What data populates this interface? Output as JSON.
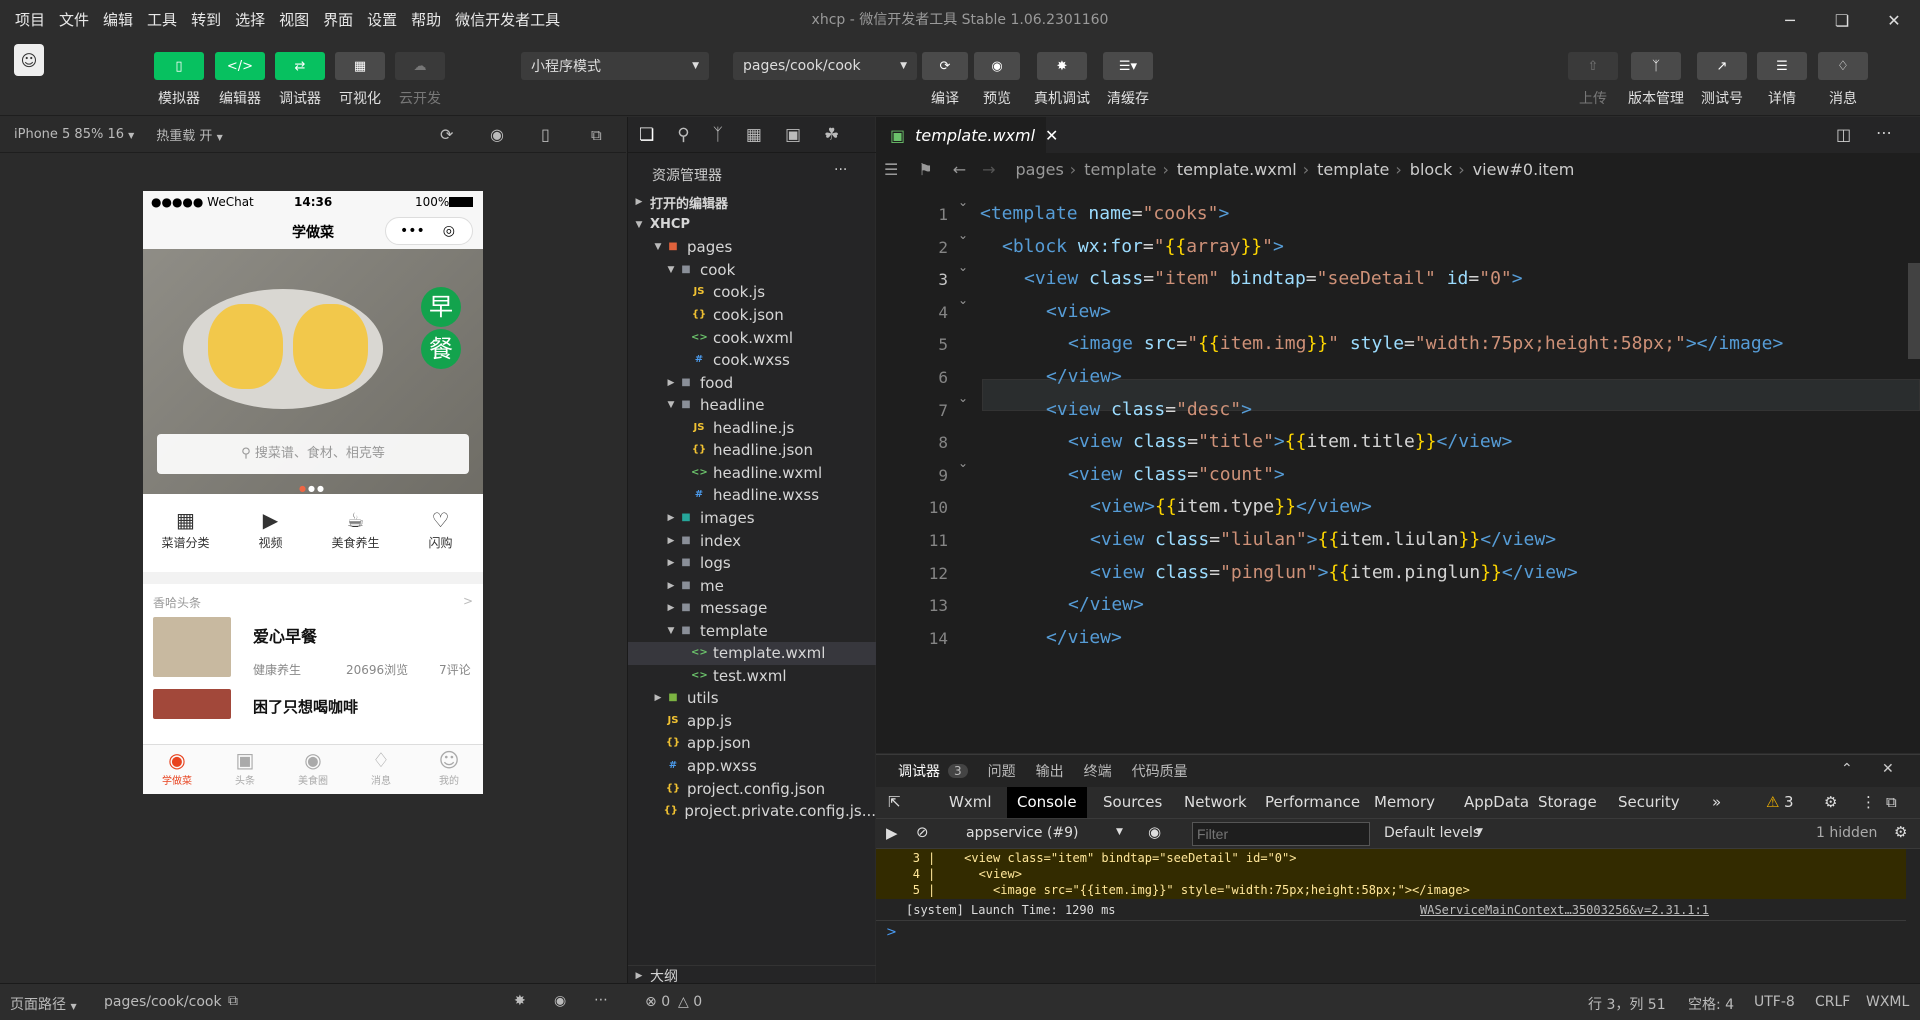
{
  "menubar": {
    "items": [
      "项目",
      "文件",
      "编辑",
      "工具",
      "转到",
      "选择",
      "视图",
      "界面",
      "设置",
      "帮助",
      "微信开发者工具"
    ],
    "title": "xhcp - 微信开发者工具 Stable 1.06.2301160"
  },
  "toolbar": {
    "simulator_label": "模拟器",
    "editor_label": "编辑器",
    "debugger_label": "调试器",
    "visual_label": "可视化",
    "cloud_label": "云开发",
    "mode_select": "小程序模式",
    "page_select": "pages/cook/cook",
    "compile_label": "编译",
    "preview_label": "预览",
    "remote_debug_label": "真机调试",
    "clear_cache_label": "清缓存",
    "upload_label": "上传",
    "version_label": "版本管理",
    "test_label": "测试号",
    "details_label": "详情",
    "messages_label": "消息"
  },
  "simulator": {
    "device": "iPhone 5 85% 16",
    "hot_reload": "热重载 开",
    "status_carrier": "●●●●● WeChat",
    "status_time": "14:36",
    "status_battery": "100%",
    "nav_title": "学做菜",
    "search_placeholder": "搜菜谱、食材、相克等",
    "banner_text_1": "早",
    "banner_text_2": "餐",
    "categories": [
      "菜谱分类",
      "视频",
      "美食养生",
      "闪购"
    ],
    "section_title": "香哈头条",
    "section_more": ">",
    "article1": {
      "title": "爱心早餐",
      "type": "健康养生",
      "views": "20696浏览",
      "comments": "7评论"
    },
    "article2": {
      "title": "困了只想喝咖啡"
    },
    "tabs": [
      "学做菜",
      "头条",
      "美食圈",
      "消息",
      "我的"
    ]
  },
  "explorer": {
    "title": "资源管理器",
    "more": "···",
    "open_editors": "打开的编辑器",
    "root": "XHCP",
    "tree": [
      {
        "label": "pages",
        "depth": 1,
        "type": "folder-red",
        "open": true
      },
      {
        "label": "cook",
        "depth": 2,
        "type": "folder",
        "open": true
      },
      {
        "label": "cook.js",
        "depth": 3,
        "type": "js"
      },
      {
        "label": "cook.json",
        "depth": 3,
        "type": "json"
      },
      {
        "label": "cook.wxml",
        "depth": 3,
        "type": "wxml"
      },
      {
        "label": "cook.wxss",
        "depth": 3,
        "type": "wxss"
      },
      {
        "label": "food",
        "depth": 2,
        "type": "folder",
        "open": false
      },
      {
        "label": "headline",
        "depth": 2,
        "type": "folder",
        "open": true
      },
      {
        "label": "headline.js",
        "depth": 3,
        "type": "js"
      },
      {
        "label": "headline.json",
        "depth": 3,
        "type": "json"
      },
      {
        "label": "headline.wxml",
        "depth": 3,
        "type": "wxml"
      },
      {
        "label": "headline.wxss",
        "depth": 3,
        "type": "wxss"
      },
      {
        "label": "images",
        "depth": 2,
        "type": "folder-img",
        "open": false
      },
      {
        "label": "index",
        "depth": 2,
        "type": "folder",
        "open": false
      },
      {
        "label": "logs",
        "depth": 2,
        "type": "folder",
        "open": false
      },
      {
        "label": "me",
        "depth": 2,
        "type": "folder",
        "open": false
      },
      {
        "label": "message",
        "depth": 2,
        "type": "folder",
        "open": false
      },
      {
        "label": "template",
        "depth": 2,
        "type": "folder",
        "open": true
      },
      {
        "label": "template.wxml",
        "depth": 3,
        "type": "wxml",
        "selected": true
      },
      {
        "label": "test.wxml",
        "depth": 3,
        "type": "wxml"
      },
      {
        "label": "utils",
        "depth": 1,
        "type": "folder-green",
        "open": false
      },
      {
        "label": "app.js",
        "depth": 1,
        "type": "js"
      },
      {
        "label": "app.json",
        "depth": 1,
        "type": "json"
      },
      {
        "label": "app.wxss",
        "depth": 1,
        "type": "wxss"
      },
      {
        "label": "project.config.json",
        "depth": 1,
        "type": "json"
      },
      {
        "label": "project.private.config.js...",
        "depth": 1,
        "type": "json"
      }
    ],
    "outline": "大纲"
  },
  "editor": {
    "tab": "template.wxml",
    "breadcrumb": [
      "pages",
      "template",
      "template.wxml",
      "template",
      "block",
      "view#0.item"
    ],
    "lines": [
      "1",
      "2",
      "3",
      "4",
      "5",
      "6",
      "7",
      "8",
      "9",
      "10",
      "11",
      "12",
      "13",
      "14"
    ]
  },
  "devtools": {
    "panel_tabs": [
      "调试器",
      "问题",
      "输出",
      "终端",
      "代码质量"
    ],
    "debugger_badge": "3",
    "tabs": [
      "Wxml",
      "Console",
      "Sources",
      "Network",
      "Performance",
      "Memory",
      "AppData",
      "Storage",
      "Security"
    ],
    "more_tabs": "»",
    "warn_count": "3",
    "context": "appservice (#9)",
    "filter_placeholder": "Filter",
    "levels": "Default levels",
    "hidden": "1 hidden",
    "warn_lines": [
      {
        "n": "3",
        "text": "    <view class=\"item\" bindtap=\"seeDetail\" id=\"0\">"
      },
      {
        "n": "4",
        "text": "      <view>"
      },
      {
        "n": "5",
        "text": "        <image src=\"{{item.img}}\" style=\"width:75px;height:58px;\"></image>"
      }
    ],
    "log_text": "[system] Launch Time: 1290 ms",
    "log_source": "WAServiceMainContext…35003256&v=2.31.1:1",
    "prompt": ">"
  },
  "status": {
    "page_path_label": "页面路径",
    "page_path": "pages/cook/cook",
    "errors": "0",
    "warnings": "0",
    "position": "行 3，列 51",
    "spaces": "空格: 4",
    "encoding": "UTF-8",
    "eol": "CRLF",
    "lang": "WXML"
  }
}
